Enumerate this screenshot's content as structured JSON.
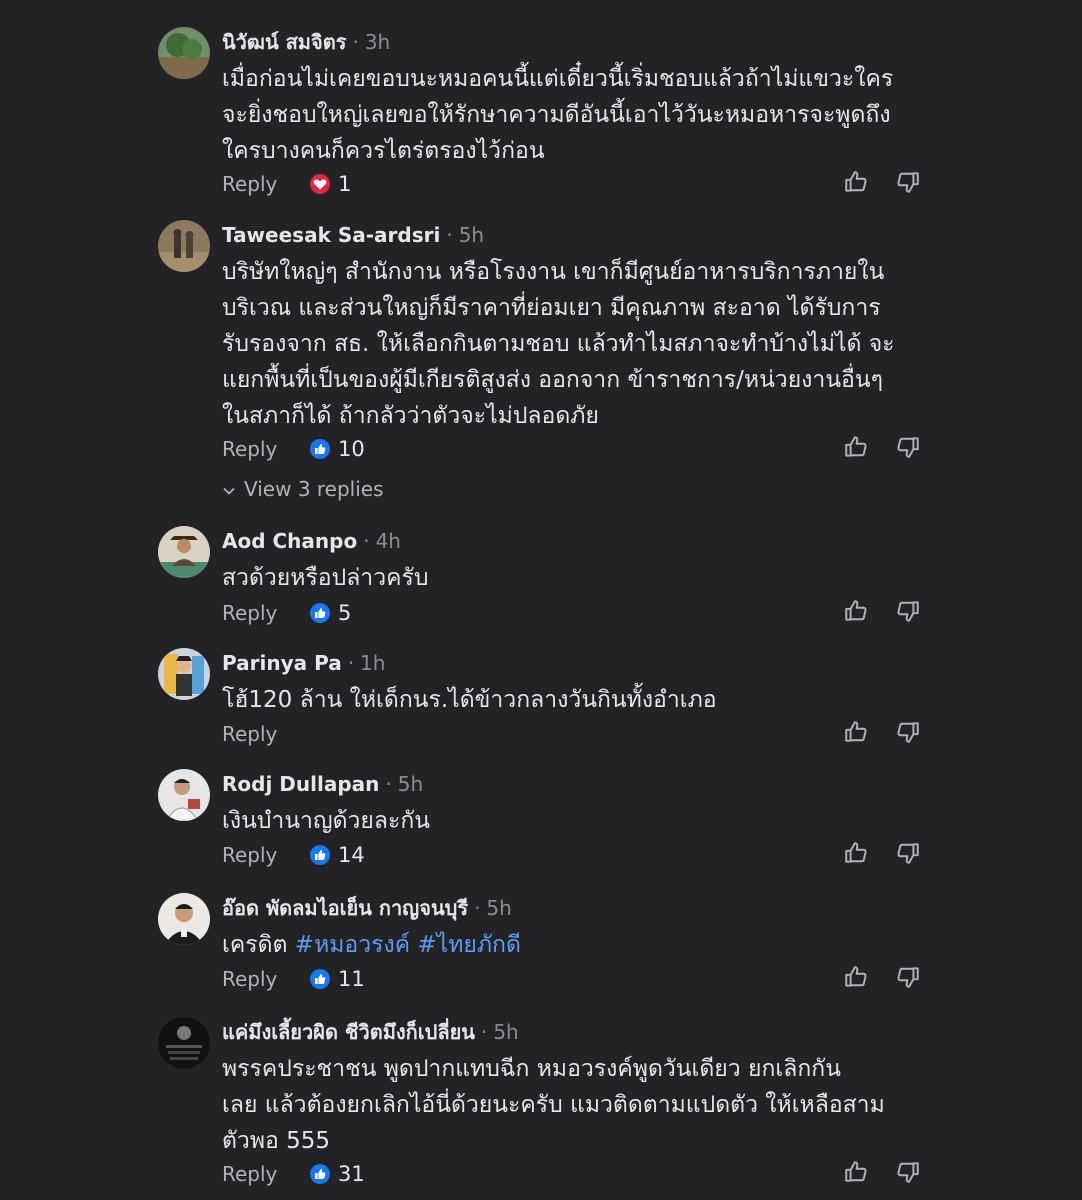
{
  "ui": {
    "reply_label": "Reply",
    "view_replies_label": "View 3 replies",
    "accent_link_color": "#5b9cf6",
    "like_reaction_color": "#1877f2",
    "love_reaction_color": "#e42645"
  },
  "comments": [
    {
      "author": "นิวัฒน์ สมจิตร",
      "time": "3h",
      "lines": [
        "เมื่อก่อนไม่เคยขอบนะหมอคนนี้แต่เดี๋ยวนี้เริ่มชอบแล้วถ้าไม่แขวะใคร",
        "จะยิ่งชอบใหญ่เลยขอให้รักษาความดีอันนี้เอาไว้วันะหมอหารจะพูดถึง",
        "ใครบางคนก็ควรไตร่ตรองไว้ก่อน"
      ],
      "reaction": "love",
      "reaction_count": "1"
    },
    {
      "author": "Taweesak Sa-ardsri",
      "time": "5h",
      "lines": [
        "บริษัทใหญ่ๆ สำนักงาน หรือโรงงาน เขาก็มีศูนย์อาหารบริการภายใน",
        "บริเวณ และส่วนใหญ่ก็มีราคาที่ย่อมเยา มีคุณภาพ สะอาด ได้รับการ",
        "รับรองจาก สธ. ให้เลือกกินตามชอบ แล้วทำไมสภาจะทำบ้างไม่ได้ จะ",
        "แยกพื้นที่เป็นของผู้มีเกียรติสูงส่ง ออกจาก  ข้าราชการ/หน่วยงานอื่นๆ",
        "ในสภาก็ได้ ถ้ากลัวว่าตัวจะไม่ปลอดภัย"
      ],
      "reaction": "like",
      "reaction_count": "10"
    },
    {
      "author": "Aod Chanpo",
      "time": "4h",
      "lines": [
        "สวด้วยหรือปล่าวครับ"
      ],
      "reaction": "like",
      "reaction_count": "5"
    },
    {
      "author": "Parinya Pa",
      "time": "1h",
      "lines": [
        "โฮ้120 ล้าน ให่เด็กนร.ได้ข้าวกลางวันกินทั้งอำเภอ"
      ],
      "reaction": "",
      "reaction_count": ""
    },
    {
      "author": "Rodj Dullapan",
      "time": "5h",
      "lines": [
        "เงินบำนาญด้วยละกัน"
      ],
      "reaction": "like",
      "reaction_count": "14"
    },
    {
      "author": "อ๊อด พัดลมไอเย็น กาญจนบุรี",
      "time": "5h",
      "text_prefix": "เครดิต ",
      "hashtags": [
        "#หมอวรงค์",
        "#ไทยภักดี"
      ],
      "reaction": "like",
      "reaction_count": "11"
    },
    {
      "author": "แค่มึงเลี้ยวผิด ชีวิตมึงก็เปลี่ยน",
      "time": "5h",
      "lines": [
        "พรรคประชาชน  พูดปากแทบฉีก  หมอวรงค์พูดวันเดียว   ยกเลิกกัน",
        "เลย  แล้วต้องยกเลิกไอ้นี่ด้วยนะครับ แมวติดตามแปดตัว  ให้เหลือสาม",
        "ตัวพอ  555"
      ],
      "reaction": "like",
      "reaction_count": "31"
    }
  ]
}
